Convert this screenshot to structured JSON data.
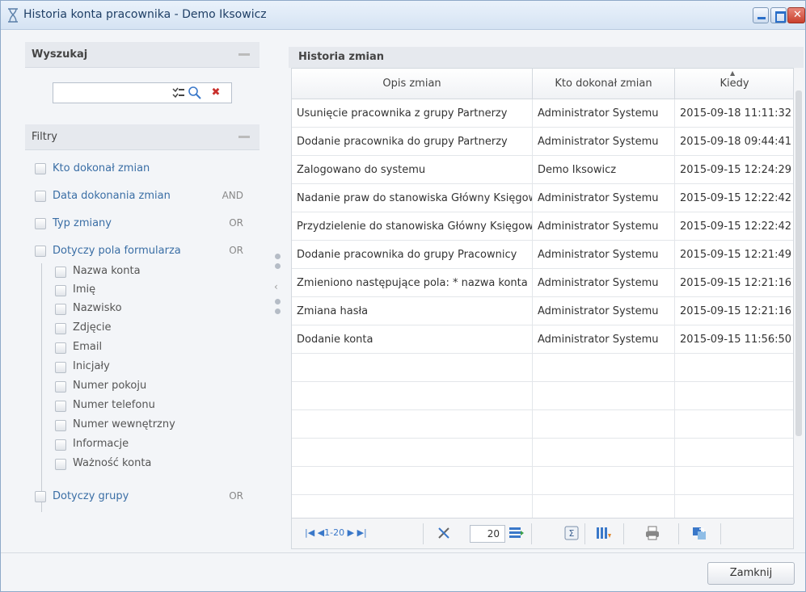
{
  "window": {
    "title": "Historia konta pracownika - Demo Iksowicz"
  },
  "search": {
    "title": "Wyszukaj",
    "value": "",
    "placeholder": ""
  },
  "filters": {
    "title": "Filtry",
    "items": [
      {
        "label": "Kto dokonał zmian",
        "op": ""
      },
      {
        "label": "Data dokonania zmian",
        "op": "AND"
      },
      {
        "label": "Typ zmiany",
        "op": "OR"
      },
      {
        "label": "Dotyczy pola formularza",
        "op": "OR"
      },
      {
        "label": "Dotyczy grupy",
        "op": "OR"
      }
    ],
    "form_fields": [
      "Nazwa konta",
      "Imię",
      "Nazwisko",
      "Zdjęcie",
      "Email",
      "Inicjały",
      "Numer pokoju",
      "Numer telefonu",
      "Numer wewnętrzny",
      "Informacje",
      "Ważność konta"
    ]
  },
  "history": {
    "title": "Historia zmian",
    "columns": [
      "Opis zmian",
      "Kto dokonał zmian",
      "Kiedy"
    ],
    "rows": [
      [
        "Usunięcie pracownika z grupy Partnerzy",
        "Administrator Systemu",
        "2015-09-18 11:11:32"
      ],
      [
        "Dodanie pracownika do grupy Partnerzy",
        "Administrator Systemu",
        "2015-09-18 09:44:41"
      ],
      [
        "Zalogowano do systemu",
        "Demo Iksowicz",
        "2015-09-15 12:24:29"
      ],
      [
        "Nadanie praw do stanowiska Główny Księgow",
        "Administrator Systemu",
        "2015-09-15 12:22:42"
      ],
      [
        "Przydzielenie do stanowiska Główny Księgowy",
        "Administrator Systemu",
        "2015-09-15 12:22:42"
      ],
      [
        "Dodanie pracownika do grupy Pracownicy",
        "Administrator Systemu",
        "2015-09-15 12:21:49"
      ],
      [
        "Zmieniono następujące pola: * nazwa konta pr",
        "Administrator Systemu",
        "2015-09-15 12:21:16"
      ],
      [
        "Zmiana hasła",
        "Administrator Systemu",
        "2015-09-15 12:21:16"
      ],
      [
        "Dodanie konta",
        "Administrator Systemu",
        "2015-09-15 11:56:50"
      ]
    ]
  },
  "pager": {
    "range": "1-20",
    "page_size": "20"
  },
  "footer": {
    "close_label": "Zamknij"
  },
  "colors": {
    "link": "#3a6ea5",
    "close_button": "#c9402d",
    "titlebar": "#d5e3f3"
  }
}
